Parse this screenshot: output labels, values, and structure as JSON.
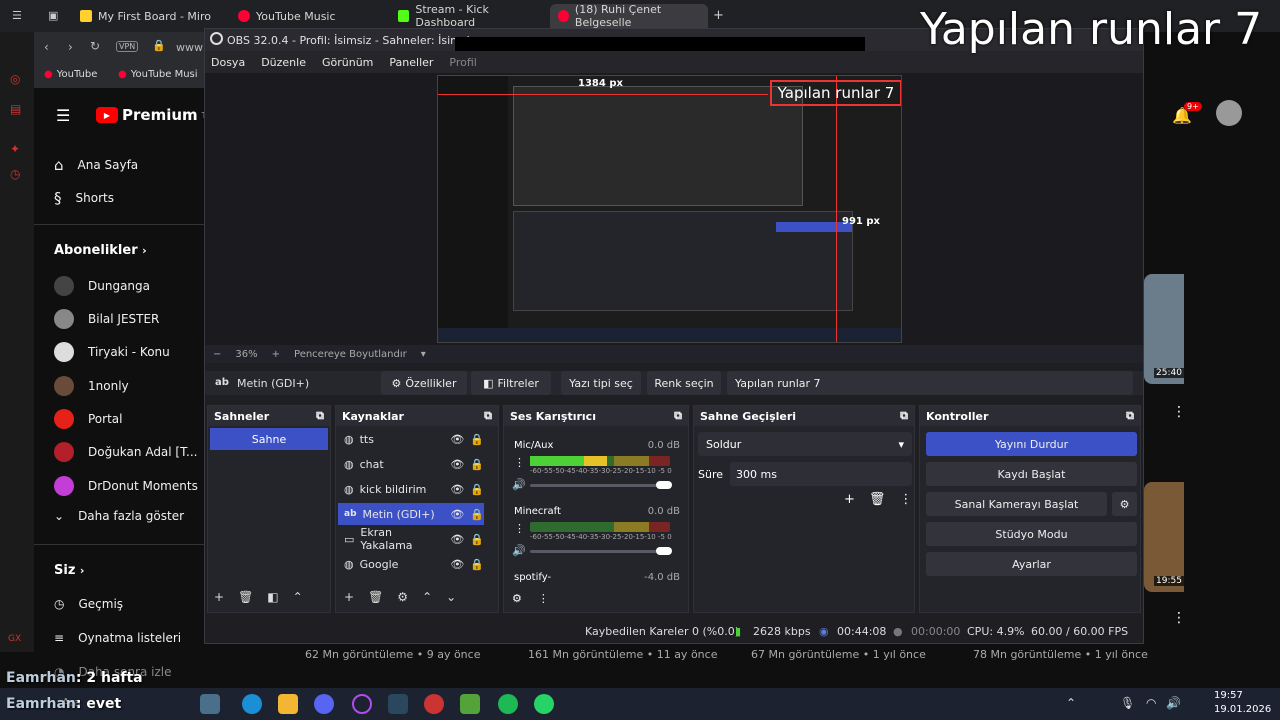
{
  "browser": {
    "tabs": [
      {
        "label": "My First Board - Miro",
        "color": "#ffd02f"
      },
      {
        "label": "YouTube Music",
        "color": "#ff0033"
      },
      {
        "label": "Stream - Kick Dashboard",
        "color": "#53fc18"
      },
      {
        "label": "(18) Ruhi Çenet Belgeselle",
        "color": "#ff0033"
      }
    ],
    "address_partial": "www",
    "vpn_label": "VPN",
    "bookmarks": [
      "YouTube",
      "YouTube Musi"
    ]
  },
  "overlay": {
    "big_text": "Yapılan runlar 7",
    "chat_lines": [
      {
        "user": "Eamrhan",
        "msg": ": 2 hafta"
      },
      {
        "user": "Eamrhan",
        "msg": ": evet"
      }
    ]
  },
  "youtube": {
    "logo": "Premium",
    "tr": "TR",
    "nav": [
      "Ana Sayfa",
      "Shorts"
    ],
    "subs_title": "Abonelikler",
    "subs": [
      {
        "name": "Dunganga",
        "color": "#444"
      },
      {
        "name": "Bilal JESTER",
        "color": "#888"
      },
      {
        "name": "Tiryaki - Konu",
        "color": "#ddd"
      },
      {
        "name": "1nonly",
        "color": "#6a4b3a"
      },
      {
        "name": "Portal",
        "color": "#e62117"
      },
      {
        "name": "Doğukan Adal [T...",
        "color": "#b3202a"
      },
      {
        "name": "DrDonut Moments",
        "color": "#c43dd6"
      }
    ],
    "more": "Daha fazla göster",
    "you_title": "Siz",
    "you_items": [
      "Geçmiş",
      "Oynatma listeleri",
      "Daha sonra izle"
    ],
    "notif_count": "9+",
    "thumb_times": [
      "25:40",
      "19:55"
    ],
    "views": [
      "62 Mn görüntüleme • 9 ay önce",
      "161 Mn görüntüleme • 11 ay önce",
      "67 Mn görüntüleme • 1 yıl önce",
      "78 Mn görüntüleme • 1 yıl önce"
    ]
  },
  "obs": {
    "title": "OBS 32.0.4 - Profil: İsimsiz - Sahneler: İsimsiz",
    "menu": [
      "Dosya",
      "Düzenle",
      "Görünüm",
      "Paneller",
      "Profil"
    ],
    "preview": {
      "px_top": "1384 px",
      "px_right": "991 px",
      "overlay_label": "Yapılan runlar 7"
    },
    "zoom": {
      "value": "36%",
      "fit": "Pencereye Boyutlandır"
    },
    "selected_source": "Metin (GDI+)",
    "prop_buttons": {
      "props": "Özellikler",
      "filters": "Filtreler",
      "font": "Yazı tipi seç",
      "color": "Renk seçin",
      "text": "Yapılan runlar 7"
    },
    "scenes": {
      "title": "Sahneler",
      "items": [
        "Sahne"
      ]
    },
    "sources": {
      "title": "Kaynaklar",
      "items": [
        {
          "name": "tts",
          "icon": "globe-icon"
        },
        {
          "name": "chat",
          "icon": "globe-icon"
        },
        {
          "name": "kick bildirim",
          "icon": "globe-icon"
        },
        {
          "name": "Metin (GDI+)",
          "icon": "text-icon"
        },
        {
          "name": "Ekran Yakalama",
          "icon": "monitor-icon"
        },
        {
          "name": "Google",
          "icon": "globe-icon"
        }
      ]
    },
    "mixer": {
      "title": "Ses Karıştırıcı",
      "channels": [
        {
          "name": "Mic/Aux",
          "db": "0.0 dB",
          "level": 0.55
        },
        {
          "name": "Minecraft",
          "db": "0.0 dB",
          "level": 0.0
        },
        {
          "name": "spotify-",
          "db": "-4.0 dB",
          "level": 0.0
        }
      ],
      "scale": "-60-55-50-45-40-35-30-25-20-15-10 -5  0"
    },
    "transitions": {
      "title": "Sahne Geçişleri",
      "type": "Soldur",
      "duration_label": "Süre",
      "duration": "300 ms"
    },
    "controls": {
      "title": "Kontroller",
      "buttons": [
        "Yayını Durdur",
        "Kaydı Başlat",
        "Sanal Kamerayı Başlat",
        "Stüdyo Modu",
        "Ayarlar"
      ]
    },
    "status": {
      "dropped": "Kaybedilen Kareler 0 (%0.0)",
      "bitrate": "2628 kbps",
      "stream_time": "00:44:08",
      "rec_time": "00:00:00",
      "cpu": "CPU: 4.9%",
      "fps": "60.00 / 60.00 FPS"
    }
  },
  "taskbar": {
    "time": "19:57",
    "date": "19.01.2026",
    "search": "Ara"
  }
}
